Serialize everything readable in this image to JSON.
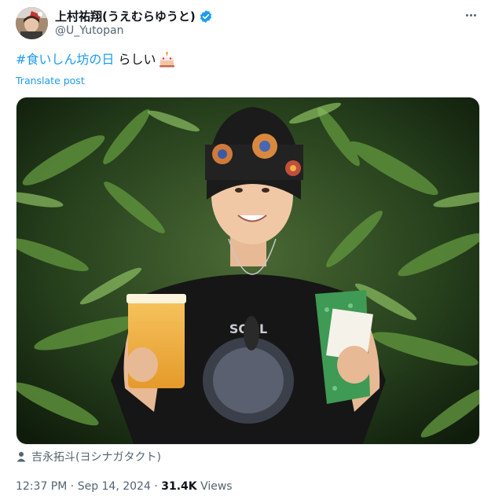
{
  "author": {
    "display_name": "上村祐翔(うえむらゆうと)",
    "handle": "@U_Yutopan",
    "verified_color": "#1d9bf0"
  },
  "post": {
    "hashtag": "#食いしん坊の日",
    "text": "らしい",
    "emoji": "birthday-cake-icon",
    "translate_label": "Translate post"
  },
  "media": {
    "tagged_person": "吉永拓斗(ヨシナガタクト)"
  },
  "meta": {
    "time": "12:37 PM",
    "separator": " · ",
    "date": "Sep 14, 2024",
    "views_count": "31.4K",
    "views_label": "Views"
  },
  "colors": {
    "accent": "#1d9bf0",
    "secondary_text": "#536471",
    "primary_text": "#0f1419"
  }
}
